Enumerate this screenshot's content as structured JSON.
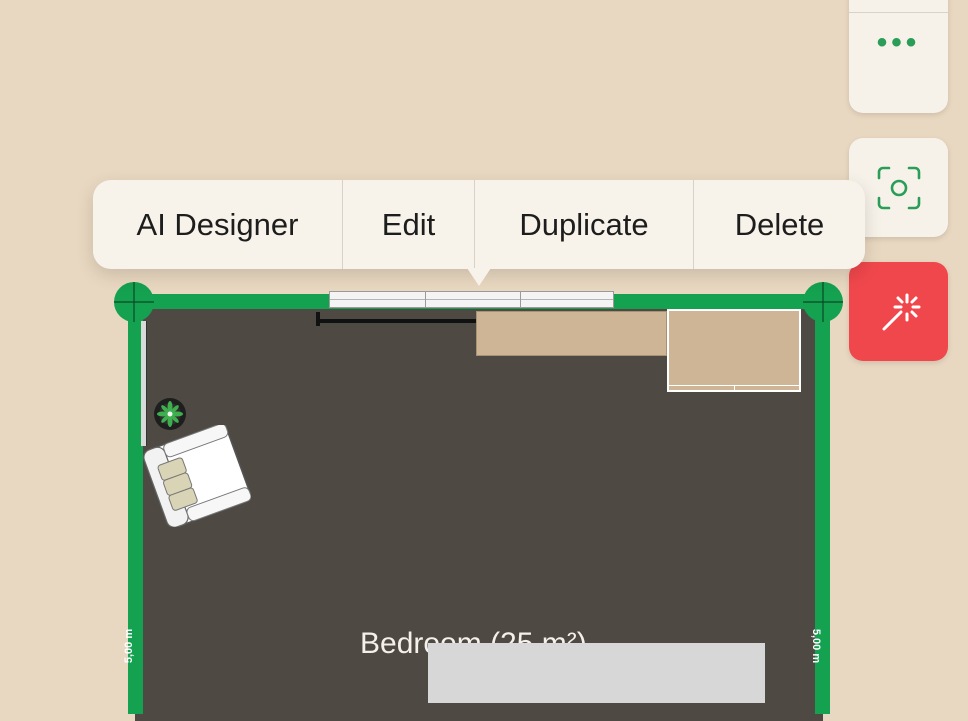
{
  "context_menu": {
    "items": [
      {
        "label": "AI Designer"
      },
      {
        "label": "Edit"
      },
      {
        "label": "Duplicate"
      },
      {
        "label": "Delete"
      }
    ]
  },
  "toolbar": {
    "more_icon": "more-dots-icon",
    "scan_icon": "scan-camera-icon",
    "magic_icon": "magic-wand-icon",
    "more_glyph": "•••"
  },
  "room": {
    "label": "Bedroom (25 m²)",
    "dimension_left": "5,00 m",
    "dimension_right": "5,00 m"
  },
  "colors": {
    "background": "#e9d8c1",
    "wall": "#14a150",
    "floor": "#4f4943",
    "accent": "#2a9d59",
    "magic_button": "#f0474c"
  }
}
